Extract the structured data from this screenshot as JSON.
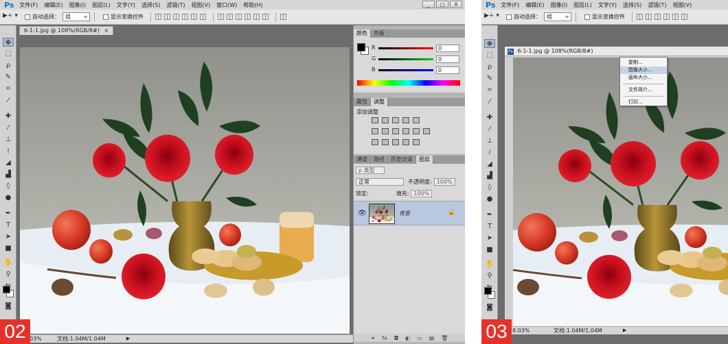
{
  "menu": {
    "logo": "Ps",
    "items": [
      "文件(F)",
      "编辑(E)",
      "图像(I)",
      "图层(L)",
      "文字(Y)",
      "选择(S)",
      "滤镜(T)",
      "视图(V)",
      "窗口(W)",
      "帮助(H)"
    ],
    "window_controls": [
      "_",
      "□",
      "X"
    ]
  },
  "options": {
    "tool_preset": "▶+ ▾",
    "auto_select_label": "自动选择：",
    "auto_select_value": "组",
    "show_transform_label": "显示变换控件"
  },
  "document": {
    "tab_title": "6-1-1.jpg @ 108%(RGB/8#)",
    "tab_close": "×",
    "zoom_status_left": "03%",
    "zoom_status_right": "8.03%",
    "doc_size": "文档:1.04M/1.04M"
  },
  "panels": {
    "color_tabs": [
      "颜色",
      "色板"
    ],
    "channels": [
      {
        "label": "R",
        "value": "0",
        "color": "#d20000"
      },
      {
        "label": "G",
        "value": "0",
        "color": "#00b000"
      },
      {
        "label": "B",
        "value": "0",
        "color": "#0000d0"
      }
    ],
    "adjust_tabs": [
      "属性",
      "调整"
    ],
    "adjust_title": "添加调整",
    "layers_tabs": [
      "通道",
      "路径",
      "历史记录",
      "图层"
    ],
    "layers_kind": "ρ 类型",
    "blend_mode": "正常",
    "opacity_label": "不透明度:",
    "opacity_value": "100%",
    "lock_label": "锁定:",
    "fill_label": "填充:",
    "fill_value": "100%",
    "layer_name": "背景"
  },
  "context_menu": {
    "items": [
      "复制...",
      "图像大小...",
      "画布大小...",
      "文件简介...",
      "打印..."
    ],
    "highlighted": "图像大小..."
  },
  "steps": [
    "02",
    "03"
  ]
}
